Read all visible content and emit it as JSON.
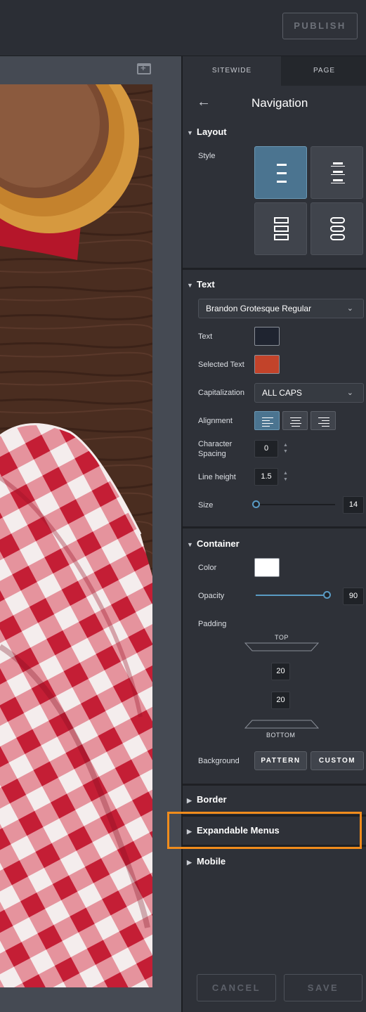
{
  "toolbar": {
    "publish_label": "PUBLISH"
  },
  "tabs": [
    {
      "label": "SITEWIDE",
      "active": true
    },
    {
      "label": "PAGE",
      "active": false
    }
  ],
  "panel": {
    "back_icon": "arrow-left-icon",
    "title": "Navigation",
    "layout": {
      "heading": "Layout",
      "style_label": "Style",
      "selected_style": "lines"
    },
    "text": {
      "heading": "Text",
      "font_value": "Brandon Grotesque Regular",
      "text_color_label": "Text",
      "text_color": "#1f2430",
      "selected_text_label": "Selected Text",
      "selected_text_color": "#c2432a",
      "capitalization_label": "Capitalization",
      "capitalization_value": "ALL CAPS",
      "alignment_label": "Alignment",
      "alignment_value": "left",
      "char_spacing_label": "Character Spacing",
      "char_spacing_value": "0",
      "line_height_label": "Line height",
      "line_height_value": "1.5",
      "size_label": "Size",
      "size_value": "14"
    },
    "container": {
      "heading": "Container",
      "color_label": "Color",
      "color": "#ffffff",
      "opacity_label": "Opacity",
      "opacity_value": "90",
      "padding_label": "Padding",
      "padding_top_label": "TOP",
      "padding_top_value": "20",
      "padding_bottom_value": "20",
      "padding_bottom_label": "BOTTOM",
      "background_label": "Background",
      "pattern_label": "PATTERN",
      "custom_label": "CUSTOM"
    },
    "collapsed_sections": [
      {
        "label": "Border"
      },
      {
        "label": "Expandable Menus"
      },
      {
        "label": "Mobile"
      }
    ],
    "cancel_label": "CANCEL",
    "save_label": "SAVE"
  },
  "colors": {
    "accent": "#4b7490",
    "highlight": "#f08c1c",
    "panel_bg": "#2e3138"
  }
}
